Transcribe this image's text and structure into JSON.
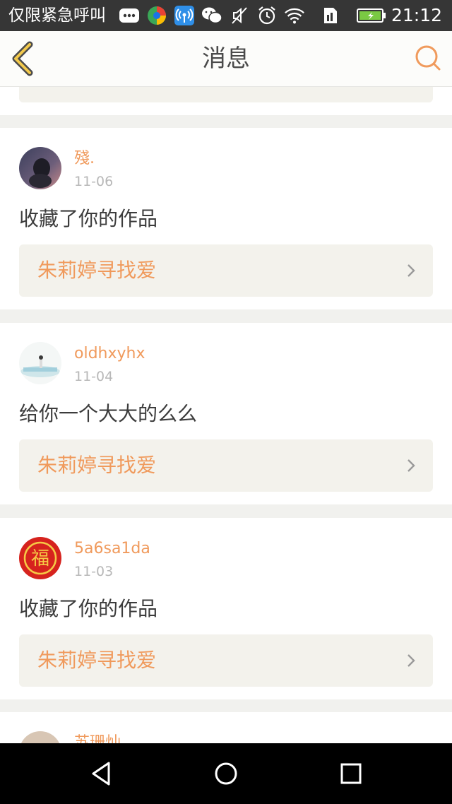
{
  "status": {
    "carrier": "仅限紧急呼叫",
    "time": "21:12"
  },
  "header": {
    "title": "消息"
  },
  "messages": [
    {
      "username": "殘.",
      "date": "11-06",
      "text": "收藏了你的作品",
      "work_title": "朱莉婷寻找爱"
    },
    {
      "username": "oldhxyhx",
      "date": "11-04",
      "text": "给你一个大大的么么",
      "work_title": "朱莉婷寻找爱"
    },
    {
      "username": "5a6sa1da",
      "date": "11-03",
      "text": "收藏了你的作品",
      "work_title": "朱莉婷寻找爱"
    },
    {
      "username": "苏珊灿",
      "date": "",
      "text": "",
      "work_title": ""
    }
  ],
  "avatar_3_char": "福",
  "colors": {
    "accent": "#f09a5c",
    "statusbar": "#363636",
    "link_bg": "#f3f2ec",
    "page_bg": "#f1f1ee"
  },
  "icons": [
    "back-arrow-icon",
    "search-icon",
    "chevron-right-icon",
    "nav-back-icon",
    "nav-home-icon",
    "nav-recents-icon"
  ]
}
